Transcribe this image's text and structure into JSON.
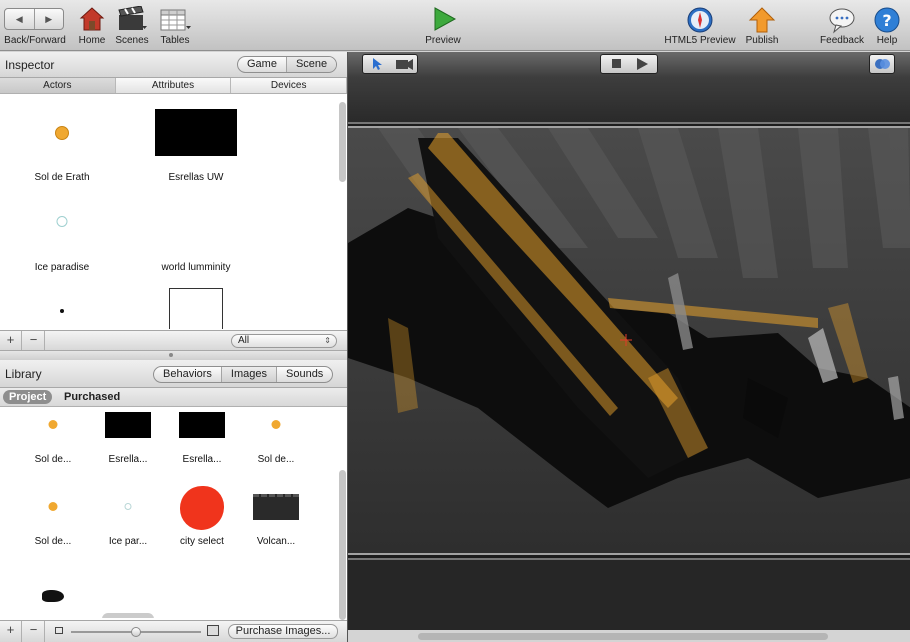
{
  "toolbar": {
    "back_forward": "Back/Forward",
    "home": "Home",
    "scenes": "Scenes",
    "tables": "Tables",
    "preview": "Preview",
    "html5_preview": "HTML5 Preview",
    "publish": "Publish",
    "feedback": "Feedback",
    "help": "Help"
  },
  "inspector": {
    "title": "Inspector",
    "mode_tabs": [
      "Game",
      "Scene"
    ],
    "active_mode": "Scene",
    "tabs": [
      "Actors",
      "Attributes",
      "Devices"
    ],
    "active_tab": "Actors",
    "actors": [
      {
        "label": "Sol de Erath",
        "thumb": "orange-dot"
      },
      {
        "label": "Esrellas UW",
        "thumb": "black-stars"
      },
      {
        "label": "Ice paradise",
        "thumb": "pale-circle"
      },
      {
        "label": "world lumminity",
        "thumb": "blank"
      },
      {
        "label": "",
        "thumb": "small-dot"
      },
      {
        "label": "",
        "thumb": "white-box"
      }
    ],
    "filter": "All"
  },
  "library": {
    "title": "Library",
    "tabs": [
      "Behaviors",
      "Images",
      "Sounds"
    ],
    "active_tab": "Images",
    "scope_tabs": [
      "Project",
      "Purchased"
    ],
    "active_scope": "Project",
    "images": [
      {
        "label": "Sol de...",
        "thumb": "orange-dot"
      },
      {
        "label": "Esrella...",
        "thumb": "black-stars"
      },
      {
        "label": "Esrella...",
        "thumb": "black-stars"
      },
      {
        "label": "Sol de...",
        "thumb": "orange-dot"
      },
      {
        "label": "Sol de...",
        "thumb": "orange-dot"
      },
      {
        "label": "Ice par...",
        "thumb": "pale-circle"
      },
      {
        "label": "city select",
        "thumb": "red-blob"
      },
      {
        "label": "Volcan...",
        "thumb": "dark-volcano"
      },
      {
        "label": "",
        "thumb": "black-splat"
      },
      {
        "label": "",
        "thumb": "gray-card"
      }
    ],
    "purchase_button": "Purchase Images...",
    "zoom_level": 0.5
  },
  "colors": {
    "accent_orange": "#e8a22c",
    "scene_bg": "#2a2a2a",
    "red_blob": "#f0341c"
  }
}
